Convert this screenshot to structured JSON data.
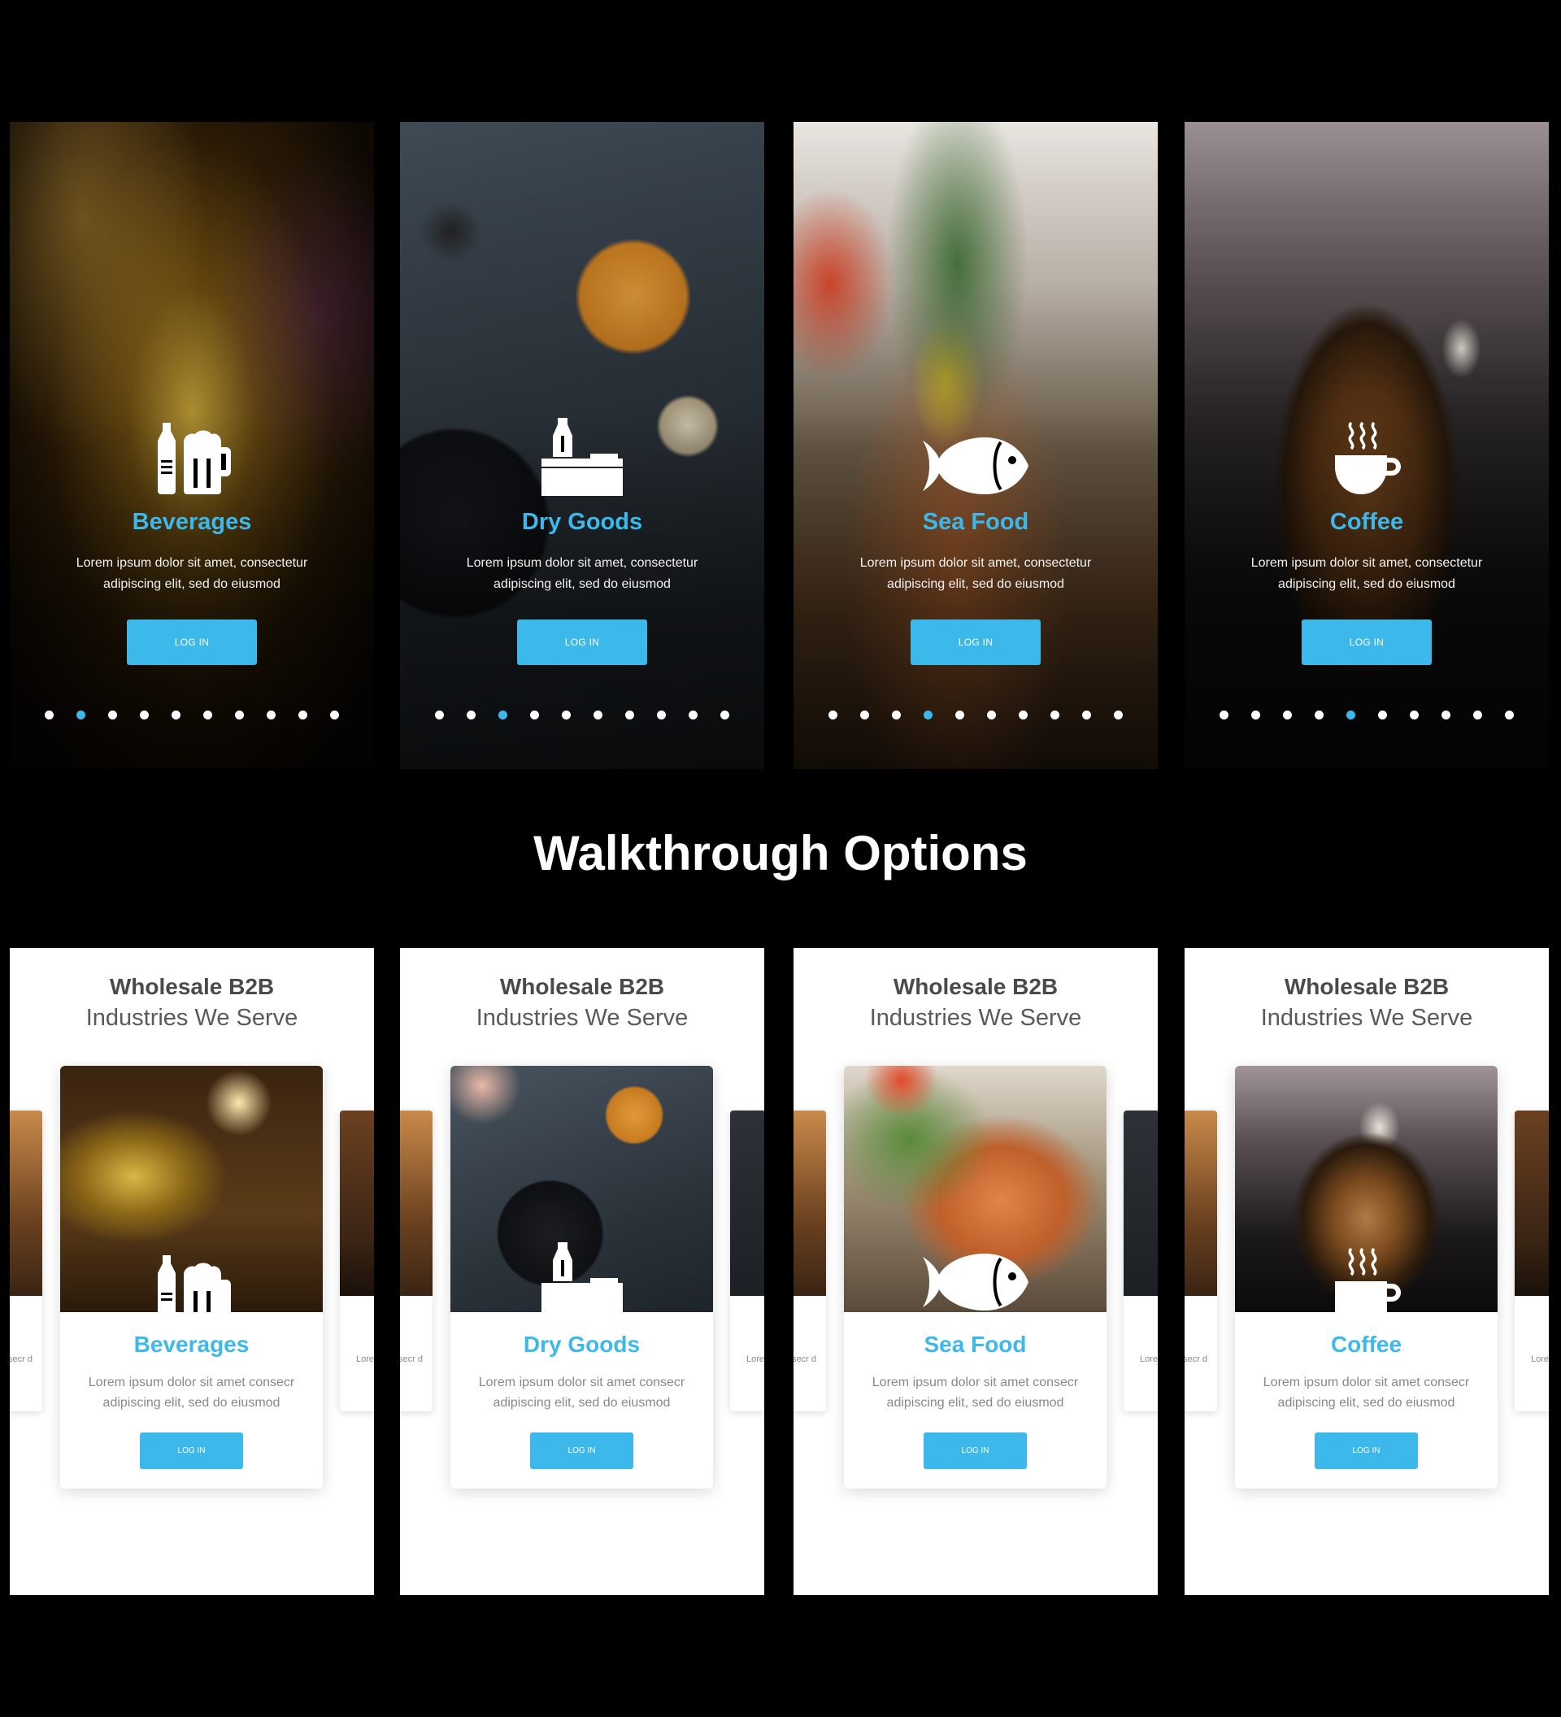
{
  "section_title": "Walkthrough Options",
  "dark_screens": [
    {
      "title": "Beverages",
      "desc": "Lorem ipsum dolor sit amet, consectetur adipiscing elit, sed do eiusmod",
      "button": "LOG IN",
      "icon": "beverages-icon",
      "active_dot": 1
    },
    {
      "title": "Dry Goods",
      "desc": "Lorem ipsum dolor sit amet, consectetur adipiscing elit, sed do eiusmod",
      "button": "LOG IN",
      "icon": "dry-goods-icon",
      "active_dot": 2
    },
    {
      "title": "Sea Food",
      "desc": "Lorem ipsum dolor sit amet, consectetur adipiscing elit, sed do eiusmod",
      "button": "LOG IN",
      "icon": "fish-icon",
      "active_dot": 3
    },
    {
      "title": "Coffee",
      "desc": "Lorem ipsum dolor sit amet, consectetur adipiscing elit, sed do eiusmod",
      "button": "LOG IN",
      "icon": "coffee-cup-icon",
      "active_dot": 4
    }
  ],
  "dot_count": 10,
  "light_screens": [
    {
      "heading": "Wholesale B2B",
      "subheading": "Industries We Serve",
      "title": "Beverages",
      "desc": "Lorem ipsum dolor sit amet consecr adipiscing elit, sed do eiusmod",
      "button": "LOG IN",
      "icon": "beverages-icon"
    },
    {
      "heading": "Wholesale B2B",
      "subheading": "Industries We Serve",
      "title": "Dry Goods",
      "desc": "Lorem ipsum dolor sit amet consecr adipiscing elit, sed do eiusmod",
      "button": "LOG IN",
      "icon": "dry-goods-icon"
    },
    {
      "heading": "Wholesale B2B",
      "subheading": "Industries We Serve",
      "title": "Sea Food",
      "desc": "Lorem ipsum dolor sit amet consecr adipiscing elit, sed do eiusmod",
      "button": "LOG IN",
      "icon": "fish-icon"
    },
    {
      "heading": "Wholesale B2B",
      "subheading": "Industries We Serve",
      "title": "Coffee",
      "desc": "Lorem ipsum dolor sit amet consecr adipiscing elit, sed do eiusmod",
      "button": "LOG IN",
      "icon": "coffee-cup-icon"
    }
  ],
  "peek_text_left": "secr d",
  "peek_text_right": "Lore a",
  "colors": {
    "accent": "#3db8ea",
    "background": "#000000",
    "card": "#ffffff"
  }
}
